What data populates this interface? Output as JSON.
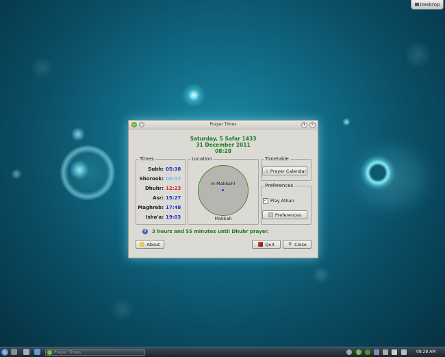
{
  "desktop": {
    "button_label": "Desktop"
  },
  "window": {
    "title": "Prayer Times",
    "date_hijri": "Saturday, 5 Safar 1433",
    "date_gregorian": "31 December 2011",
    "time": "08:28",
    "times_group": "Times",
    "location_group": "Location",
    "timetable_group": "Timetable",
    "preferences_group": "Preferences",
    "prayers": [
      {
        "name": "Subh:",
        "time": "05:38",
        "color": "#1a2fd0"
      },
      {
        "name": "Shorook:",
        "time": "06:57",
        "color": "#7ab8e8"
      },
      {
        "name": "Dhuhr:",
        "time": "12:23",
        "color": "#e02020"
      },
      {
        "name": "Asr:",
        "time": "15:27",
        "color": "#1a2fd0"
      },
      {
        "name": "Maghreb:",
        "time": "17:48",
        "color": "#1a2fd0"
      },
      {
        "name": "Isha'a:",
        "time": "19:03",
        "color": "#1a2fd0"
      }
    ],
    "location_text": "In Makkah!",
    "location_name": "Makkah",
    "prayer_calendar_button": "Prayer Calendar",
    "play_athan_label": "Play Athan",
    "play_athan_checked": true,
    "preferences_button": "Preferences",
    "status_message": "3 hours and 55 minutes until Dhuhr prayer.",
    "about_button": "About",
    "quit_button": "Quit",
    "close_button": "Close"
  },
  "taskbar": {
    "task_label": "Prayer Times",
    "clock": "08:28 AM"
  }
}
